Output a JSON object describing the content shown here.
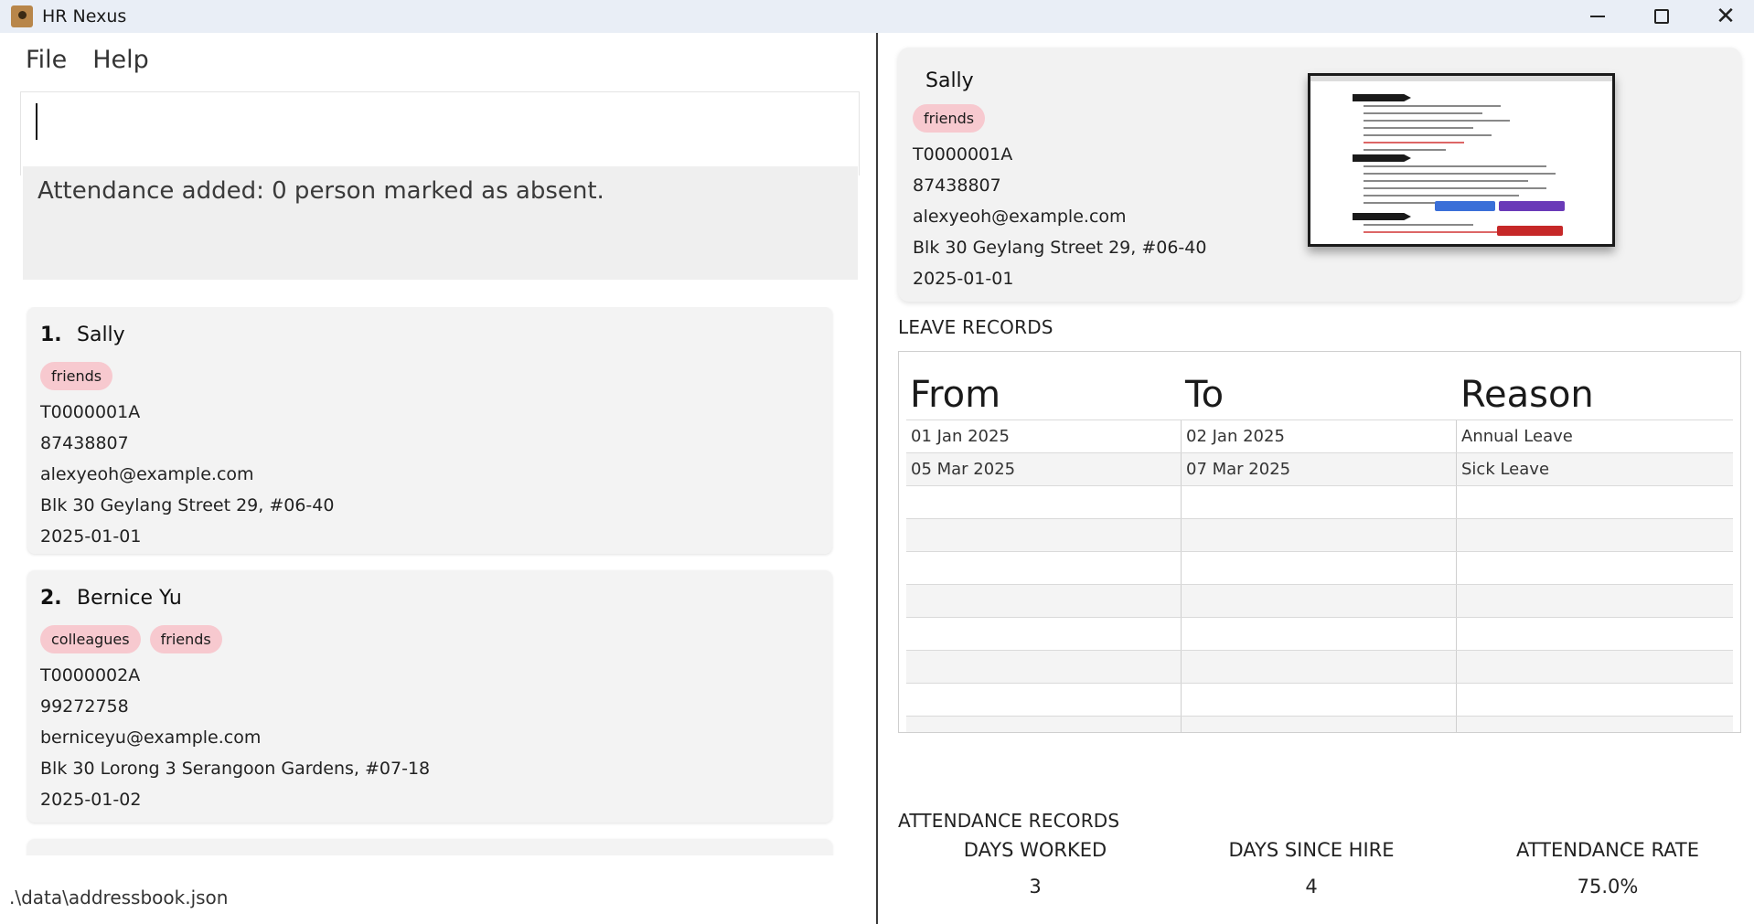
{
  "window": {
    "title": "HR Nexus"
  },
  "menu": {
    "file": "File",
    "help": "Help"
  },
  "command": {
    "value": ""
  },
  "result": {
    "message": "Attendance added: 0 person marked as absent."
  },
  "persons": [
    {
      "index": "1.",
      "name": "Sally",
      "tags": [
        "friends"
      ],
      "id": "T0000001A",
      "phone": "87438807",
      "email": "alexyeoh@example.com",
      "address": "Blk 30 Geylang Street 29, #06-40",
      "hire_date": "2025-01-01"
    },
    {
      "index": "2.",
      "name": "Bernice Yu",
      "tags": [
        "colleagues",
        "friends"
      ],
      "id": "T0000002A",
      "phone": "99272758",
      "email": "berniceyu@example.com",
      "address": "Blk 30 Lorong 3 Serangoon Gardens, #07-18",
      "hire_date": "2025-01-02"
    }
  ],
  "status_bar": {
    "path": ".\\data\\addressbook.json"
  },
  "detail": {
    "name": "Sally",
    "tag": "friends",
    "id": "T0000001A",
    "phone": "87438807",
    "email": "alexyeoh@example.com",
    "address": "Blk 30 Geylang Street 29, #06-40",
    "hire_date": "2025-01-01"
  },
  "leave": {
    "title": "LEAVE RECORDS",
    "headers": {
      "from": "From",
      "to": "To",
      "reason": "Reason"
    },
    "rows": [
      {
        "from": "01 Jan 2025",
        "to": "02 Jan 2025",
        "reason": "Annual Leave"
      },
      {
        "from": "05 Mar 2025",
        "to": "07 Mar 2025",
        "reason": "Sick Leave"
      }
    ]
  },
  "attendance": {
    "title": "ATTENDANCE RECORDS",
    "days_worked_label": "DAYS WORKED",
    "days_worked": "3",
    "days_since_hire_label": "DAYS SINCE HIRE",
    "days_since_hire": "4",
    "rate_label": "ATTENDANCE RATE",
    "rate": "75.0%"
  },
  "colors": {
    "tag_bg": "#f7c9cf",
    "divider": "#3a3a3a",
    "card_bg": "#f3f3f3"
  },
  "icons": {
    "app": "person-icon",
    "minimize": "minimize-icon",
    "maximize": "maximize-icon",
    "close": "close-icon"
  }
}
